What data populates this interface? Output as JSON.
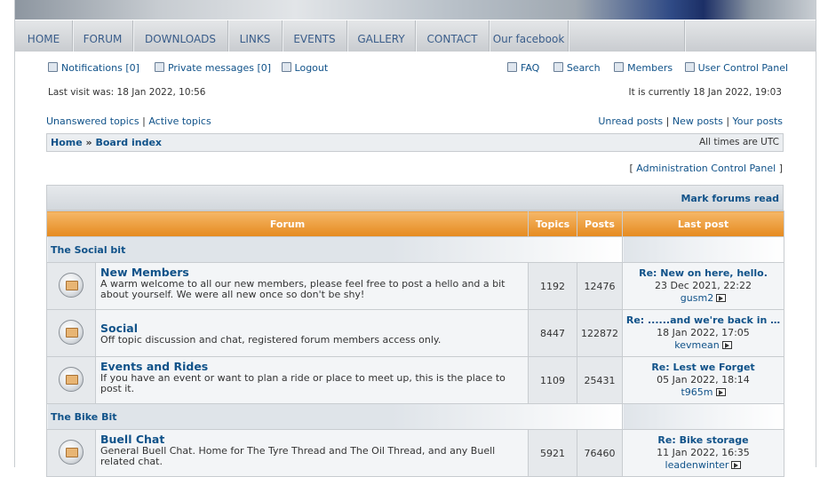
{
  "nav": [
    "HOME",
    "FORUM",
    "DOWNLOADS",
    "LINKS",
    "EVENTS",
    "GALLERY",
    "CONTACT",
    "Our facebook"
  ],
  "user": {
    "notifications_label": "Notifications [0]",
    "pm_label": "Private messages [0]",
    "logout_label": "Logout",
    "faq_label": "FAQ",
    "search_label": "Search",
    "members_label": "Members",
    "ucp_label": "User Control Panel",
    "last_visit": "Last visit was: 18 Jan 2022, 10:56",
    "current_time": "It is currently 18 Jan 2022, 19:03"
  },
  "quicklinks": {
    "unanswered": "Unanswered topics",
    "active": "Active topics",
    "unread": "Unread posts",
    "new": "New posts",
    "yours": "Your posts"
  },
  "breadcrumb": {
    "home": "Home",
    "sep": "»",
    "board": "Board index",
    "timezone": "All times are UTC"
  },
  "acp": {
    "open": "[",
    "label": "Administration Control Panel",
    "close": "]"
  },
  "mark_read": "Mark forums read",
  "table_headers": {
    "forum": "Forum",
    "topics": "Topics",
    "posts": "Posts",
    "last_post": "Last post"
  },
  "categories": [
    {
      "name": "The Social bit",
      "forums": [
        {
          "title": "New Members",
          "desc": "A warm welcome to all our new members, please feel free to post a hello and a bit about yourself. We were all new once so don't be shy!",
          "topics": "1192",
          "posts": "12476",
          "lp_title": "Re: New on here, hello.",
          "lp_date": "23 Dec 2021, 22:22",
          "lp_user": "gusm2"
        },
        {
          "title": "Social",
          "desc": "Off topic discussion and chat, registered forum members access only.",
          "topics": "8447",
          "posts": "122872",
          "lp_title": "Re: ......and we're back in …",
          "lp_date": "18 Jan 2022, 17:05",
          "lp_user": "kevmean"
        },
        {
          "title": "Events and Rides",
          "desc": "If you have an event or want to plan a ride or place to meet up, this is the place to post it.",
          "topics": "1109",
          "posts": "25431",
          "lp_title": "Re: Lest we Forget",
          "lp_date": "05 Jan 2022, 18:14",
          "lp_user": "t965m"
        }
      ]
    },
    {
      "name": "The Bike Bit",
      "forums": [
        {
          "title": "Buell Chat",
          "desc": "General Buell Chat. Home for The Tyre Thread and The Oil Thread, and any Buell related chat.",
          "topics": "5921",
          "posts": "76460",
          "lp_title": "Re: Bike storage",
          "lp_date": "11 Jan 2022, 16:35",
          "lp_user": "leadenwinter"
        }
      ]
    }
  ]
}
